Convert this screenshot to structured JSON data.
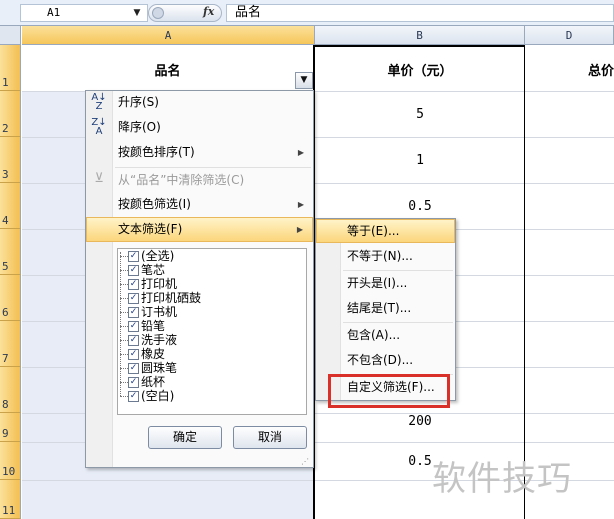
{
  "formula_bar": {
    "name_box": "A1",
    "fx": "fx",
    "formula": "品名"
  },
  "columns": [
    "A",
    "B",
    "D"
  ],
  "rows": [
    "1",
    "2",
    "3",
    "4",
    "5",
    "6",
    "7",
    "8",
    "9",
    "10",
    "11"
  ],
  "cells": {
    "a1": "品名",
    "b1": "单价（元）",
    "d1": "总价",
    "b_values": [
      "5",
      "1",
      "0.5",
      "200",
      "0.5"
    ]
  },
  "filter_menu": {
    "items": [
      {
        "label": "升序(S)",
        "icon": "sort-ascending-icon",
        "glyph_top": "A",
        "glyph_bottom": "Z"
      },
      {
        "label": "降序(O)",
        "icon": "sort-descending-icon",
        "glyph_top": "Z",
        "glyph_bottom": "A"
      },
      {
        "label": "按颜色排序(T)"
      },
      {
        "label": "从“品名”中清除筛选(C)",
        "icon": "clear-filter-icon"
      },
      {
        "label": "按颜色筛选(I)"
      },
      {
        "label": "文本筛选(F)"
      }
    ],
    "checklist": [
      "(全选)",
      "笔芯",
      "打印机",
      "打印机硒鼓",
      "订书机",
      "铅笔",
      "洗手液",
      "橡皮",
      "圆珠笔",
      "纸杯",
      "(空白)"
    ],
    "ok": "确定",
    "cancel": "取消"
  },
  "text_filter_submenu": {
    "items": [
      "等于(E)...",
      "不等于(N)...",
      "开头是(I)...",
      "结尾是(T)...",
      "包含(A)...",
      "不包含(D)...",
      "自定义筛选(F)..."
    ]
  },
  "watermark": "软件技巧",
  "colors": {
    "highlight": "#fbd67c",
    "selection": "#f6c65b",
    "annotation": "#d9302a"
  }
}
